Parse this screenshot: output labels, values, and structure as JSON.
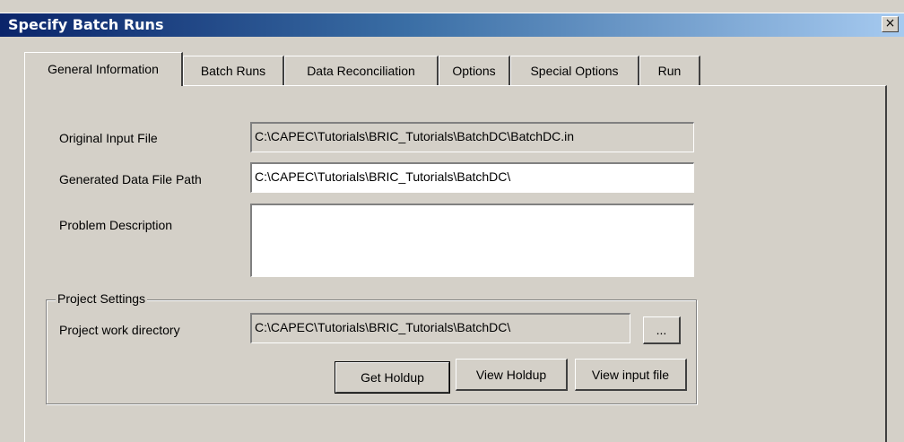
{
  "window": {
    "title": "Specify Batch Runs",
    "close_label": "×"
  },
  "tabs": [
    {
      "label": "General Information",
      "active": true
    },
    {
      "label": "Batch Runs",
      "active": false
    },
    {
      "label": "Data Reconciliation",
      "active": false
    },
    {
      "label": "Options",
      "active": false
    },
    {
      "label": "Special Options",
      "active": false
    },
    {
      "label": "Run",
      "active": false
    }
  ],
  "form": {
    "original_input_label": "Original Input File",
    "original_input_value": "C:\\CAPEC\\Tutorials\\BRIC_Tutorials\\BatchDC\\BatchDC.in",
    "generated_path_label": "Generated Data File Path",
    "generated_path_value": "C:\\CAPEC\\Tutorials\\BRIC_Tutorials\\BatchDC\\",
    "problem_description_label": "Problem Description",
    "problem_description_value": ""
  },
  "project_settings": {
    "legend": "Project Settings",
    "work_dir_label": "Project work directory",
    "work_dir_value": "C:\\CAPEC\\Tutorials\\BRIC_Tutorials\\BatchDC\\",
    "browse_label": "...",
    "get_holdup_label": "Get Holdup",
    "view_holdup_label": "View Holdup",
    "view_input_label": "View input file"
  }
}
